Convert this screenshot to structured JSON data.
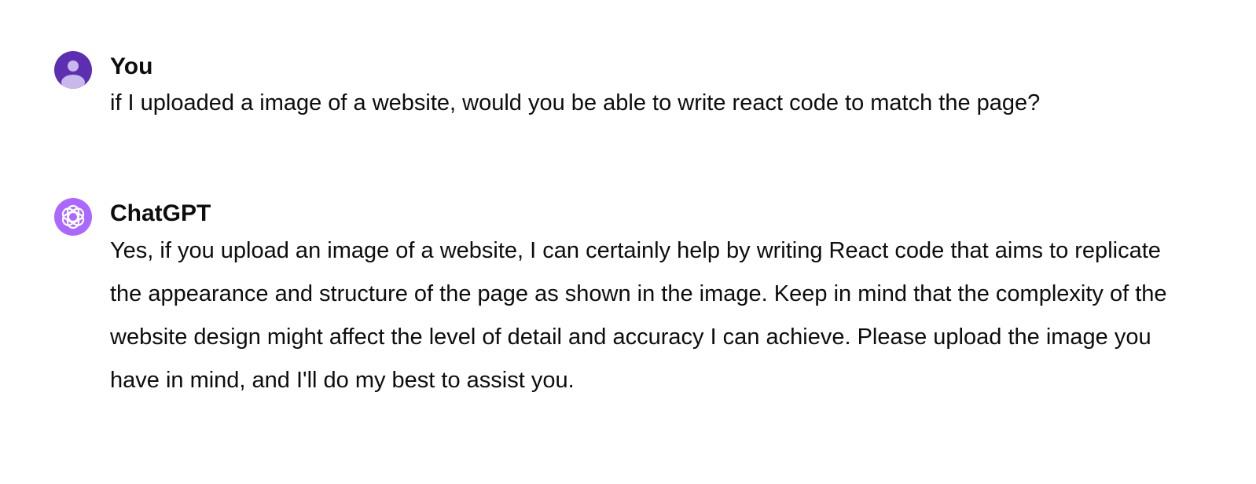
{
  "conversation": {
    "messages": [
      {
        "author": "You",
        "avatar_icon": "user-avatar-icon",
        "avatar_color": "#5b2fb0",
        "text": "if I uploaded a image of a website, would you be able to write react code to match the page?"
      },
      {
        "author": "ChatGPT",
        "avatar_icon": "chatgpt-logo-icon",
        "avatar_color": "#ab68ff",
        "text": "Yes, if you upload an image of a website, I can certainly help by writing React code that aims to replicate the appearance and structure of the page as shown in the image. Keep in mind that the complexity of the website design might affect the level of detail and accuracy I can achieve. Please upload the image you have in mind, and I'll do my best to assist you."
      }
    ]
  }
}
